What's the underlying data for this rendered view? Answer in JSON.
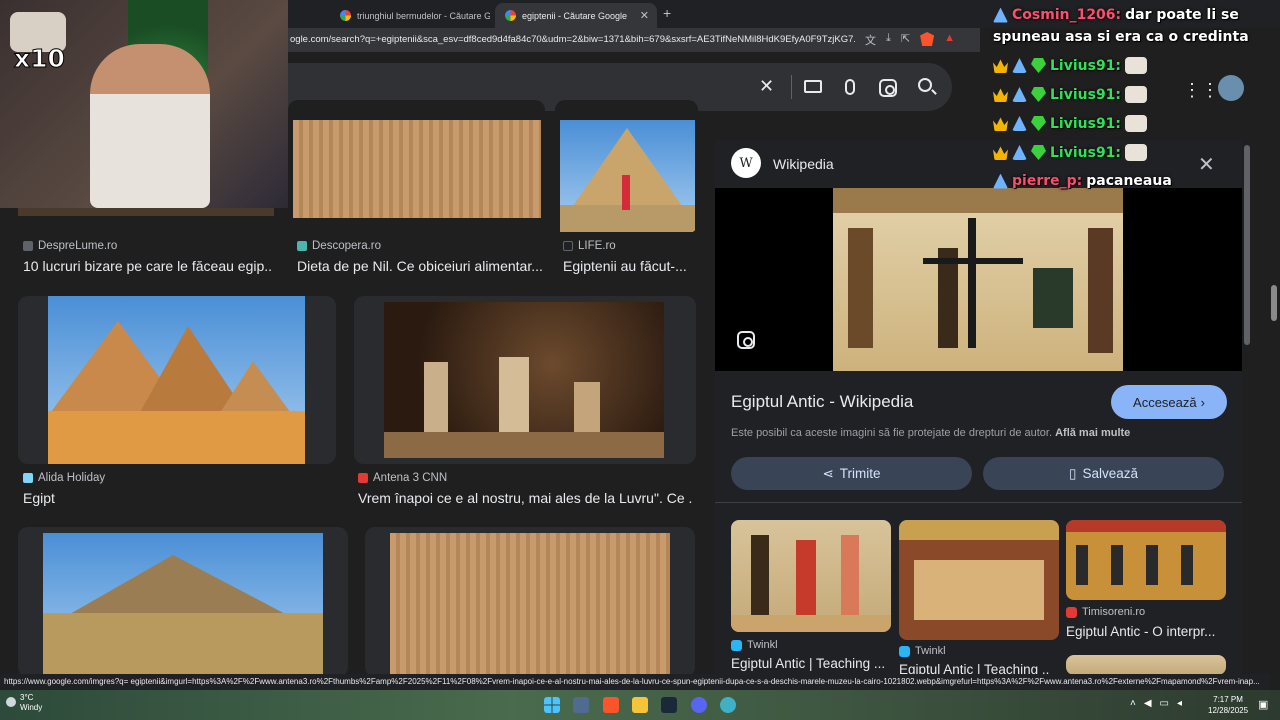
{
  "browser": {
    "tabs": [
      {
        "title": "triunghiul bermudelor - Căutare Goog",
        "active": false
      },
      {
        "title": "egiptenii - Căutare Google",
        "active": true
      }
    ],
    "url": "ogle.com/search?q=+egiptenii&sca_esv=df8ced9d4fa84c70&udm=2&biw=1371&bih=679&sxsrf=AE3TifNeNMil8HdK9EfyA0F9TzjKG7..."
  },
  "results": [
    {
      "source": "DespreLume.ro",
      "title": "10 lucruri bizare pe care le făceau egip...",
      "favicon_color": "#5f6368"
    },
    {
      "source": "Descopera.ro",
      "title": "Dieta de pe Nil. Ce obiceiuri alimentar...",
      "favicon_color": "#4db6ac"
    },
    {
      "source": "LIFE.ro",
      "title": "Egiptenii au făcut-...",
      "favicon_color": "#202124"
    },
    {
      "source": "Alida Holiday",
      "title": "Egipt",
      "favicon_color": "#81d4fa"
    },
    {
      "source": "Antena 3 CNN",
      "title": "Vrem înapoi ce e al nostru, mai ales de la Luvru\". Ce ...",
      "favicon_color": "#e53935"
    }
  ],
  "panel": {
    "site_logo": "W",
    "site": "Wikipedia",
    "title": "Egiptul Antic - Wikipedia",
    "visit_label": "Accesează",
    "copyright_text": "Este posibil ca aceste imagini să fie protejate de drepturi de autor.",
    "learn_more": "Află mai multe",
    "share_label": "Trimite",
    "save_label": "Salvează",
    "related": [
      {
        "source": "Twinkl",
        "title": "Egiptul Antic | Teaching ...",
        "favicon_color": "#29b6f6"
      },
      {
        "source": "Twinkl",
        "title": "Egiptul Antic | Teaching ...",
        "favicon_color": "#29b6f6"
      },
      {
        "source": "Timisoreni.ro",
        "title": "Egiptul Antic - O interpr...",
        "favicon_color": "#e53935"
      }
    ]
  },
  "stream": {
    "multiplier": "x10",
    "chat": [
      {
        "user": "Cosmin_1206:",
        "user_color": "#ff4d6d",
        "message": "dar poate li se",
        "badges": [
          "sub"
        ]
      },
      {
        "user": "",
        "user_color": "#ffffff",
        "message": "spuneau asa si era ca o credinta",
        "badges": []
      },
      {
        "user": "Livius91:",
        "user_color": "#33e05a",
        "message": "",
        "badges": [
          "crown",
          "sub",
          "gem"
        ],
        "emote": true
      },
      {
        "user": "Livius91:",
        "user_color": "#33e05a",
        "message": "",
        "badges": [
          "crown",
          "sub",
          "gem"
        ],
        "emote": true
      },
      {
        "user": "Livius91:",
        "user_color": "#33e05a",
        "message": "",
        "badges": [
          "crown",
          "sub",
          "gem"
        ],
        "emote": true
      },
      {
        "user": "Livius91:",
        "user_color": "#33e05a",
        "message": "",
        "badges": [
          "crown",
          "sub",
          "gem"
        ],
        "emote": true
      },
      {
        "user": "pierre_p:",
        "user_color": "#ff4d6d",
        "message": "pacaneaua",
        "badges": [
          "sub"
        ]
      }
    ]
  },
  "status_url": "https://www.google.com/imgres?q= egiptenii&imgurl=https%3A%2F%2Fwww.antena3.ro%2Fthumbs%2Famp%2F2025%2F11%2F08%2Fvrem-inapoi-ce-e-al-nostru-mai-ales-de-la-luvru-ce-spun-egiptenii-dupa-ce-s-a-deschis-marele-muzeu-la-cairo-1021802.webp&imgrefurl=https%3A%2F%2Fwww.antena3.ro%2Fexterne%2Fmapamond%2Fvrem-inap...",
  "taskbar": {
    "temp": "3°C",
    "weather": "Windy",
    "time": "7:17 PM",
    "date": "12/28/2025"
  }
}
